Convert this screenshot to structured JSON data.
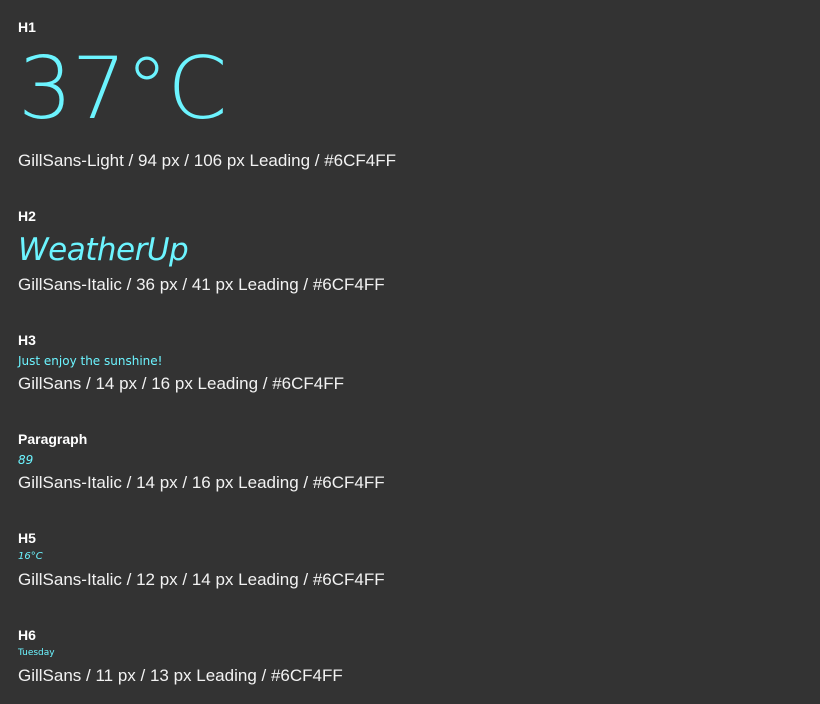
{
  "sections": {
    "h1": {
      "label": "H1",
      "sample": "37°C",
      "spec": "GillSans-Light / 94 px / 106 px Leading / #6CF4FF"
    },
    "h2": {
      "label": "H2",
      "sample": "WeatherUp",
      "spec": "GillSans-Italic / 36 px / 41 px Leading / #6CF4FF"
    },
    "h3": {
      "label": "H3",
      "sample": "Just enjoy the sunshine!",
      "spec": "GillSans / 14 px / 16 px Leading / #6CF4FF"
    },
    "paragraph": {
      "label": "Paragraph",
      "sample": "89",
      "spec": "GillSans-Italic / 14 px / 16 px Leading / #6CF4FF"
    },
    "h5": {
      "label": "H5",
      "sample": "16°C",
      "spec": "GillSans-Italic / 12 px / 14 px Leading / #6CF4FF"
    },
    "h6": {
      "label": "H6",
      "sample": "Tuesday",
      "spec": "GillSans / 11 px / 13 px Leading / #6CF4FF"
    }
  },
  "colors": {
    "background": "#333333",
    "accent": "#6CF4FF",
    "label": "#FFFFFF"
  }
}
